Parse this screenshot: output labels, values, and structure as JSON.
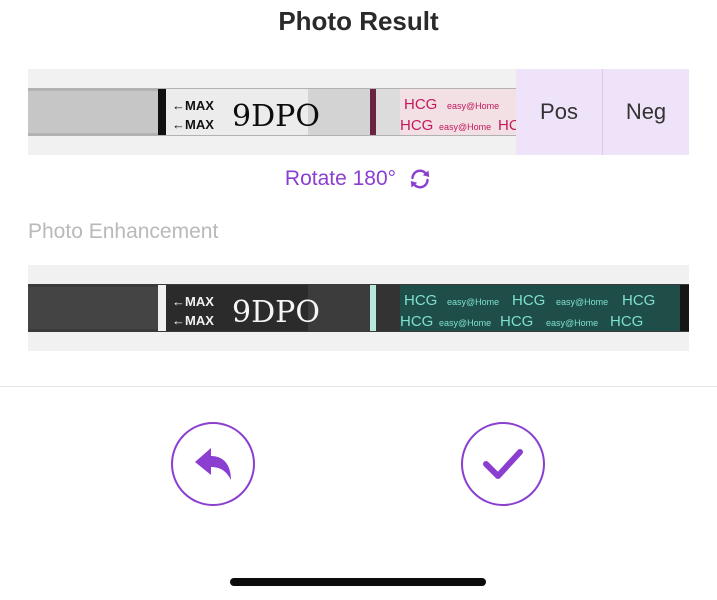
{
  "header": {
    "title": "Photo Result"
  },
  "result_options": {
    "pos_label": "Pos",
    "neg_label": "Neg"
  },
  "rotate": {
    "label": "Rotate 180°",
    "icon": "rotate-icon"
  },
  "enhancement": {
    "label": "Photo Enhancement"
  },
  "strip_text": {
    "max_label": "←MAX",
    "handwriting": "9DPO",
    "hcg": "HCG",
    "brand": "easy@Home"
  },
  "actions": {
    "back_icon": "undo-icon",
    "confirm_icon": "checkmark-icon"
  },
  "colors": {
    "accent": "#8a3fd1",
    "button_bg": "#efe3fa",
    "hcg_pink": "#c2185b",
    "hcg_teal": "#7fe0cf"
  }
}
